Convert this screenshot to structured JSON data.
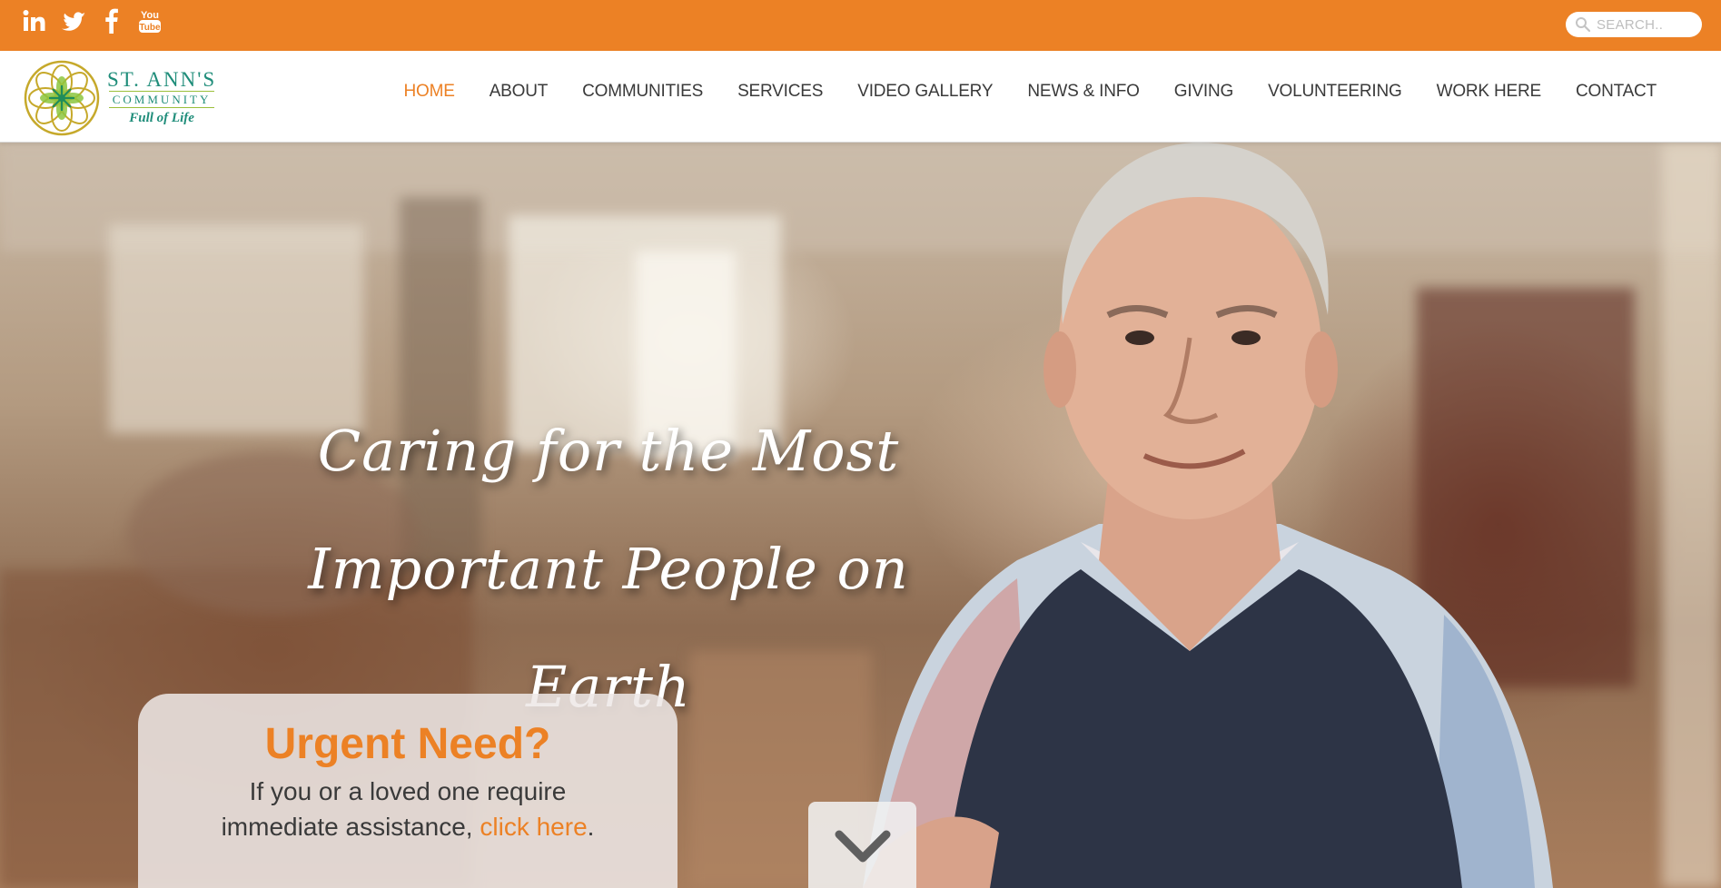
{
  "social": {
    "icons": [
      "linkedin-icon",
      "twitter-icon",
      "facebook-icon",
      "youtube-icon"
    ],
    "youtube_label": "You Tube"
  },
  "search": {
    "placeholder": "SEARCH.."
  },
  "logo": {
    "name": "ST. ANN'S",
    "sub": "COMMUNITY",
    "tagline": "Full of Life"
  },
  "nav": {
    "items": [
      {
        "label": "HOME",
        "active": true
      },
      {
        "label": "ABOUT"
      },
      {
        "label": "COMMUNITIES"
      },
      {
        "label": "SERVICES"
      },
      {
        "label": "VIDEO GALLERY"
      },
      {
        "label": "NEWS & INFO"
      },
      {
        "label": "GIVING"
      },
      {
        "label": "VOLUNTEERING"
      },
      {
        "label": "WORK HERE"
      },
      {
        "label": "CONTACT"
      }
    ]
  },
  "hero": {
    "headline_line1": "Caring for the Most",
    "headline_line2": "Important People on Earth"
  },
  "urgent": {
    "title": "Urgent Need?",
    "text_line1": "If you or a loved one require",
    "text_line2": "immediate assistance,",
    "link": "click here",
    "end": "."
  },
  "colors": {
    "brand_orange": "#ec8125",
    "logo_green": "#1f8d7a",
    "nav_text": "#3a3a3a"
  }
}
